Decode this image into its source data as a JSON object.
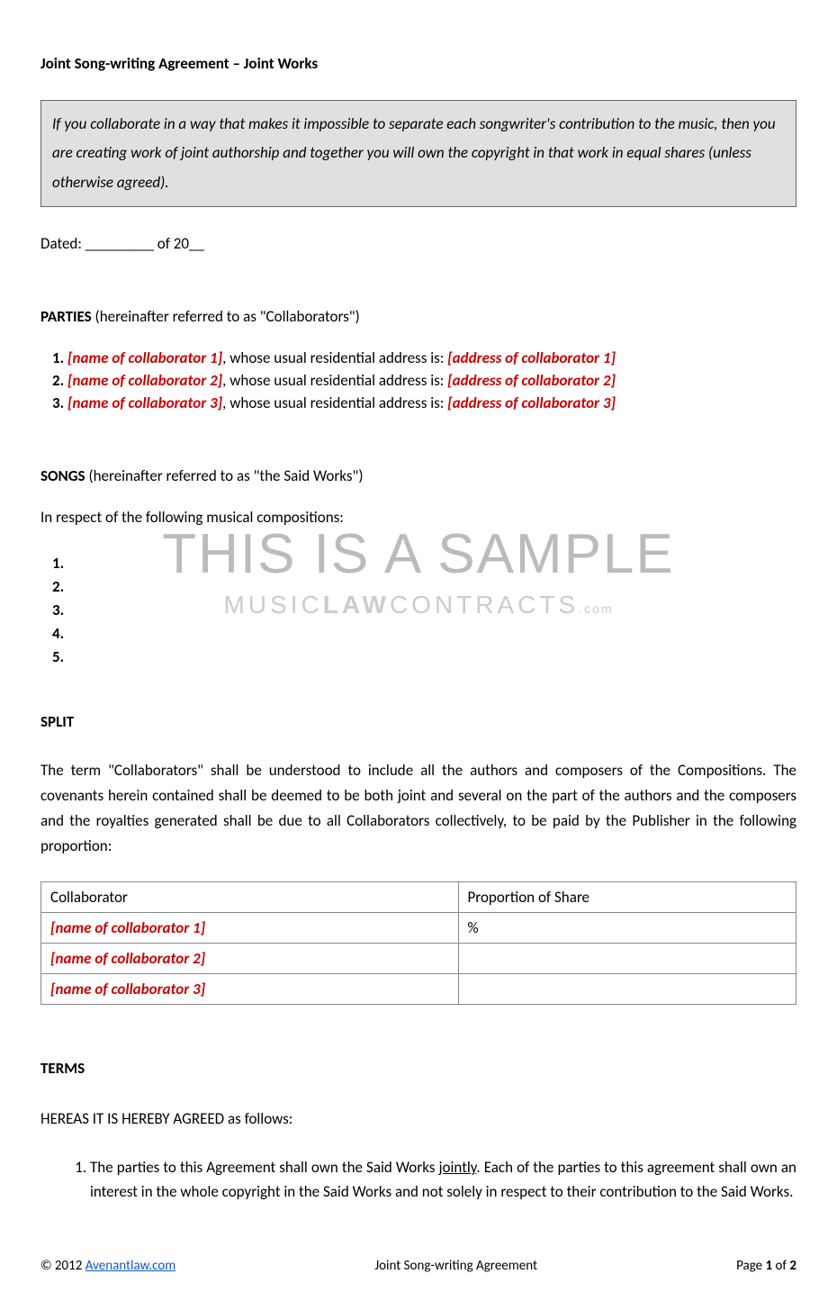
{
  "title": "Joint Song-writing Agreement – Joint Works",
  "intro_box": "If you collaborate in a way that makes it impossible to separate each songwriter's contribution to the music, then you are creating work of joint authorship and together you will own the copyright in that work in equal shares (unless otherwise agreed).",
  "dated": "Dated: _________ of 20__",
  "parties": {
    "heading_bold": "PARTIES",
    "heading_rest": " (hereinafter referred to as \"Collaborators\")",
    "items": [
      {
        "name": "[name of collaborator 1]",
        "mid": ", whose usual residential address is: ",
        "addr": "[address of collaborator 1]"
      },
      {
        "name": "[name of collaborator 2]",
        "mid": ", whose usual residential address is: ",
        "addr": "[address of collaborator 2]"
      },
      {
        "name": "[name of collaborator 3]",
        "mid": ",  whose usual residential address is: ",
        "addr": "[address of collaborator 3]"
      }
    ]
  },
  "songs": {
    "heading_bold": "SONGS",
    "heading_rest": " (hereinafter referred to as \"the Said Works\")",
    "intro": "In respect of the following musical compositions:",
    "items": [
      "",
      "",
      "",
      "",
      ""
    ]
  },
  "split": {
    "heading": "SPLIT",
    "body": "The term \"Collaborators\" shall be understood to include all the authors and composers of the Compositions. The covenants herein contained shall be deemed to be both joint and several on the part of the authors and the composers and the royalties generated shall be due to all Collaborators collectively, to be paid by the Publisher in the following proportion:",
    "table": {
      "col1": "Collaborator",
      "col2": "Proportion of Share",
      "rows": [
        {
          "name": "[name of collaborator 1]",
          "share": "%"
        },
        {
          "name": "[name of collaborator 2]",
          "share": ""
        },
        {
          "name": "[name of collaborator 3]",
          "share": ""
        }
      ]
    }
  },
  "terms": {
    "heading": "TERMS",
    "intro": "HEREAS IT IS HEREBY AGREED as follows:",
    "item1_pre": "The parties to this Agreement shall own the Said Works ",
    "item1_u": "jointly",
    "item1_post": ". Each of the parties to this agreement shall own an interest in the whole copyright in the Said Works and not solely in respect to their contribution to the Said Works."
  },
  "watermark": {
    "line1": "THIS IS A SAMPLE",
    "line2_pre": "MUSIC",
    "line2_bold": "LAW",
    "line2_post": "CONTRACTS",
    "line2_dom": ".com"
  },
  "footer": {
    "copyright": "© 2012 ",
    "link": "Avenantlaw.com",
    "center": "Joint Song-writing Agreement",
    "page_pre": "Page ",
    "page_cur": "1",
    "page_mid": " of ",
    "page_tot": "2"
  }
}
